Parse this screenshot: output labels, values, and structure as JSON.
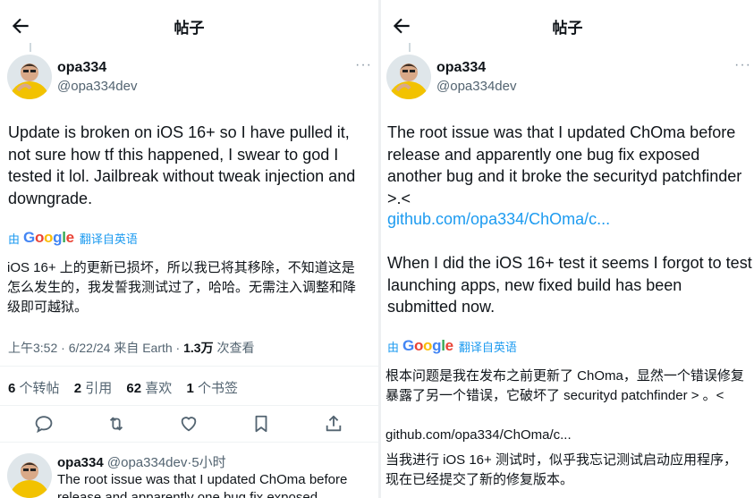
{
  "left": {
    "header": {
      "title": "帖子"
    },
    "tweet": {
      "author_name": "opa334",
      "author_handle": "@opa334dev",
      "text": "Update is broken on iOS 16+ so I have pulled it, not sure how tf this happened, I swear to god I tested it lol. Jailbreak without tweak injection and downgrade.",
      "translate_prefix": "由",
      "translate_action": "翻译自英语",
      "translated_text": "iOS 16+ 上的更新已损坏，所以我已将其移除，不知道这是怎么发生的，我发誓我测试过了，哈哈。无需注入调整和降级即可越狱。",
      "time": "上午3:52",
      "date": "6/22/24",
      "source": "来自 Earth",
      "views_count": "1.3万",
      "views_label": "次查看",
      "retweets_count": "6",
      "retweets_label": "个转帖",
      "quotes_count": "2",
      "quotes_label": "引用",
      "likes_count": "62",
      "likes_label": "喜欢",
      "bookmarks_count": "1",
      "bookmarks_label": "个书签"
    },
    "reply": {
      "author_name": "opa334",
      "author_handle": "@opa334dev",
      "time": "5小时",
      "text": "The root issue was that I updated ChOma before release and apparently one bug fix exposed"
    }
  },
  "right": {
    "header": {
      "title": "帖子"
    },
    "tweet": {
      "author_name": "opa334",
      "author_handle": "@opa334dev",
      "text_part1": "The root issue was that I updated ChOma before release and apparently one bug fix exposed another bug and it broke the securityd patchfinder >.<",
      "link": "github.com/opa334/ChOma/c...",
      "text_part2": "When I did the iOS 16+ test it seems I forgot to test launching apps, new fixed build has been submitted now.",
      "translate_prefix": "由",
      "translate_action": "翻译自英语",
      "translated_part1": "根本问题是我在发布之前更新了 ChOma，显然一个错误修复暴露了另一个错误，它破坏了 securityd patchfinder > 。<",
      "translated_link": "github.com/opa334/ChOma/c...",
      "translated_part2": "当我进行 iOS 16+ 测试时，似乎我忘记测试启动应用程序，现在已经提交了新的修复版本。"
    }
  },
  "colors": {
    "link": "#1d9bf0",
    "secondary": "#536471",
    "text": "#0f1419"
  },
  "icons": [
    "back-arrow-icon",
    "more-icon",
    "reply-icon",
    "retweet-icon",
    "like-icon",
    "bookmark-icon",
    "share-icon",
    "google-logo"
  ]
}
